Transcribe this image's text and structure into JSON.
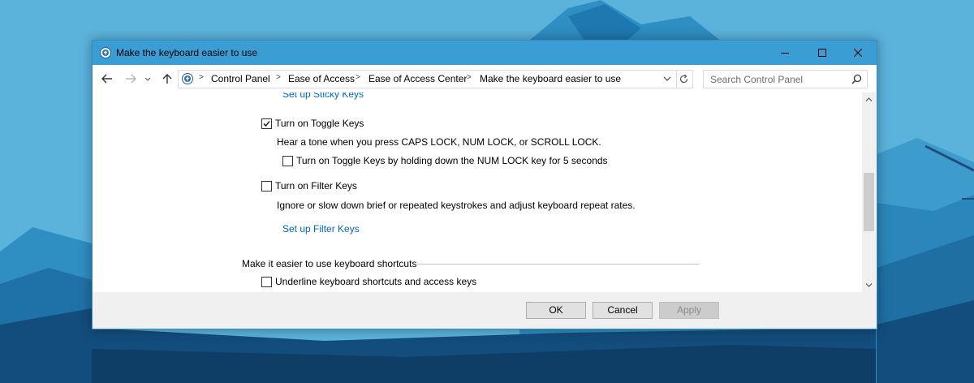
{
  "window": {
    "title": "Make the keyboard easier to use"
  },
  "address_bar": {
    "breadcrumbs": [
      "Control Panel",
      "Ease of Access",
      "Ease of Access Center",
      "Make the keyboard easier to use"
    ]
  },
  "search": {
    "placeholder": "Search Control Panel"
  },
  "content": {
    "sticky_keys_link": "Set up Sticky Keys",
    "toggle_keys": {
      "label": "Turn on Toggle Keys",
      "checked": true,
      "description": "Hear a tone when you press CAPS LOCK, NUM LOCK, or SCROLL LOCK.",
      "hold_option": {
        "label": "Turn on Toggle Keys by holding down the NUM LOCK key for 5 seconds",
        "checked": false
      }
    },
    "filter_keys": {
      "label": "Turn on Filter Keys",
      "checked": false,
      "description": "Ignore or slow down brief or repeated keystrokes and adjust keyboard repeat rates.",
      "link": "Set up Filter Keys"
    },
    "shortcuts_group": {
      "heading": "Make it easier to use keyboard shortcuts",
      "underline_option": {
        "label": "Underline keyboard shortcuts and access keys",
        "checked": false
      }
    }
  },
  "footer": {
    "ok": "OK",
    "cancel": "Cancel",
    "apply": "Apply"
  },
  "colors": {
    "titlebar": "#3a9ed4",
    "link": "#0066cc",
    "desktop": "#5bb3dc"
  }
}
